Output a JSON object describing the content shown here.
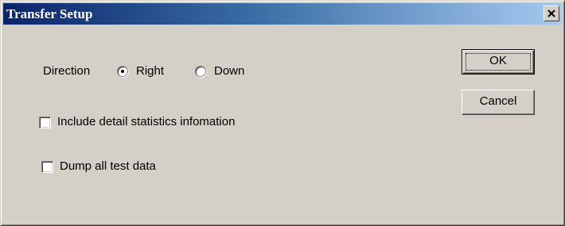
{
  "window": {
    "title": "Transfer Setup",
    "close_glyph": "×"
  },
  "direction": {
    "label": "Direction",
    "options": [
      {
        "label": "Right",
        "selected": true
      },
      {
        "label": "Down",
        "selected": false
      }
    ]
  },
  "checkboxes": [
    {
      "label": "Include detail statistics infomation",
      "checked": false
    },
    {
      "label": "Dump all test data",
      "checked": false
    }
  ],
  "buttons": {
    "ok": "OK",
    "cancel": "Cancel"
  },
  "colors": {
    "face": "#d4d0c8",
    "title_start": "#0a246a",
    "title_end": "#a6caf0"
  }
}
